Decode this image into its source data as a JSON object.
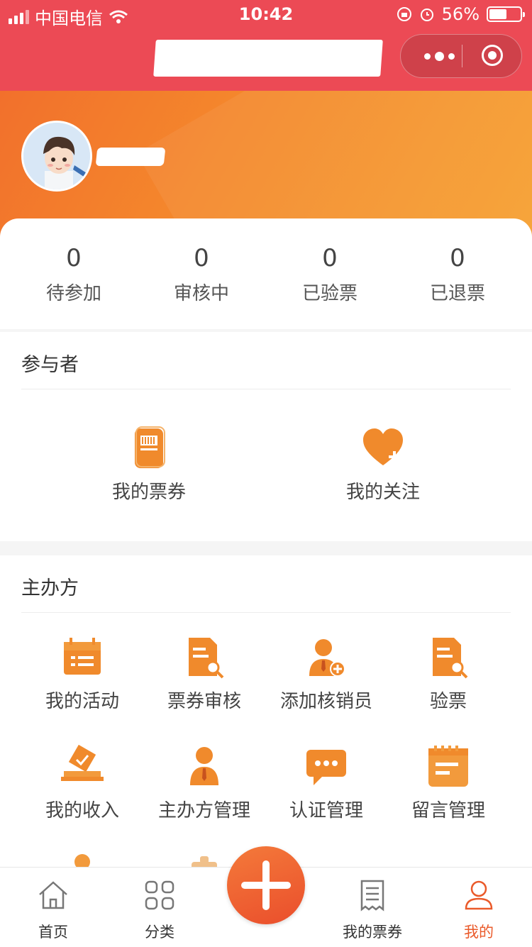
{
  "status": {
    "carrier": "中国电信",
    "time": "10:42",
    "battery": "56%",
    "battery_level": 0.56
  },
  "stats": [
    {
      "value": "0",
      "label": "待参加"
    },
    {
      "value": "0",
      "label": "审核中"
    },
    {
      "value": "0",
      "label": "已验票"
    },
    {
      "value": "0",
      "label": "已退票"
    }
  ],
  "participant": {
    "title": "参与者",
    "items": [
      {
        "label": "我的票券"
      },
      {
        "label": "我的关注"
      }
    ]
  },
  "organizer": {
    "title": "主办方",
    "items": [
      {
        "label": "我的活动"
      },
      {
        "label": "票券审核"
      },
      {
        "label": "添加核销员"
      },
      {
        "label": "验票"
      },
      {
        "label": "我的收入"
      },
      {
        "label": "主办方管理"
      },
      {
        "label": "认证管理"
      },
      {
        "label": "留言管理"
      }
    ]
  },
  "tabs": [
    {
      "label": "首页"
    },
    {
      "label": "分类"
    },
    {
      "label": "我的票券"
    },
    {
      "label": "我的"
    }
  ],
  "colors": {
    "brand_red": "#ec4a55",
    "accent_orange": "#f28a2e",
    "active_tab": "#ea5a2a"
  }
}
